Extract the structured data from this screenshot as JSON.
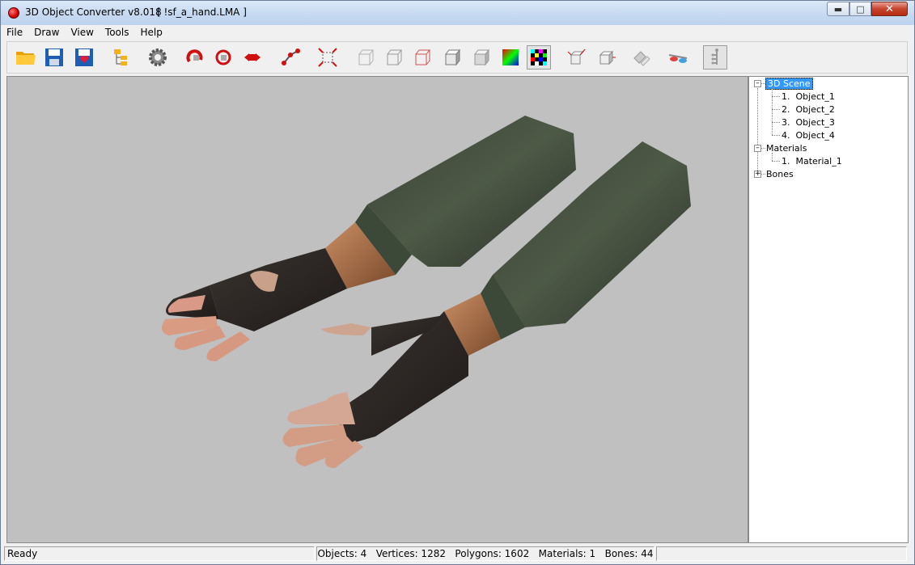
{
  "window": {
    "app_title": "3D Object Converter v8.018",
    "file_title": "[ !sf_a_hand.LMA ]"
  },
  "menu": [
    {
      "label": "File"
    },
    {
      "label": "Draw"
    },
    {
      "label": "View"
    },
    {
      "label": "Tools"
    },
    {
      "label": "Help"
    }
  ],
  "toolbar": {
    "buttons": [
      "open-folder-icon",
      "save-icon",
      "save-as-icon",
      "scene-tree-icon",
      "settings-gear-icon",
      "rotate-icon",
      "rotate-free-icon",
      "move-icon",
      "pan-icon",
      "zoom-icon",
      "wireframe-box-icon",
      "wireframe-box-2-icon",
      "wireframe-box-red-icon",
      "flat-shaded-box-icon",
      "smooth-shaded-box-icon",
      "color-cube-icon",
      "texture-checker-icon",
      "normals-box-icon",
      "box-axis-icon",
      "mirror-icon",
      "glasses-icon",
      "bones-icon"
    ]
  },
  "tree": {
    "scene_label": "3D Scene",
    "objects": [
      {
        "num": "1.",
        "name": "Object_1"
      },
      {
        "num": "2.",
        "name": "Object_2"
      },
      {
        "num": "3.",
        "name": "Object_3"
      },
      {
        "num": "4.",
        "name": "Object_4"
      }
    ],
    "materials_label": "Materials",
    "materials": [
      {
        "num": "1.",
        "name": "Material_1"
      }
    ],
    "bones_label": "Bones"
  },
  "status": {
    "ready": "Ready",
    "stats": "Objects: 4   Vertices: 1282   Polygons: 1602   Materials: 1   Bones: 44"
  }
}
